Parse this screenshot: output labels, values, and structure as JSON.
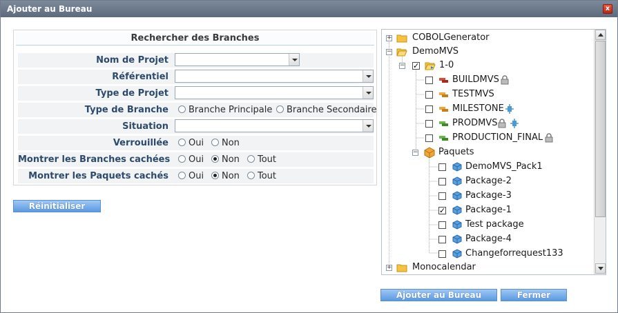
{
  "window": {
    "title": "Ajouter au Bureau",
    "close_label": "x"
  },
  "search": {
    "title": "Rechercher des Branches",
    "fields": {
      "nom_projet": {
        "label": "Nom de Projet",
        "value": ""
      },
      "referentiel": {
        "label": "Référentiel",
        "value": ""
      },
      "type_projet": {
        "label": "Type de Projet",
        "value": ""
      },
      "type_branche": {
        "label": "Type de Branche",
        "options": [
          "Branche Principale",
          "Branche Secondaire"
        ],
        "selected": null
      },
      "situation": {
        "label": "Situation",
        "value": ""
      },
      "verrouillee": {
        "label": "Verrouillée",
        "options": [
          "Oui",
          "Non"
        ],
        "selected": null
      },
      "branches_cachees": {
        "label": "Montrer les Branches cachées",
        "options": [
          "Oui",
          "Non",
          "Tout"
        ],
        "selected": "Non"
      },
      "paquets_caches": {
        "label": "Montrer les Paquets cachés",
        "options": [
          "Oui",
          "Non",
          "Tout"
        ],
        "selected": "Non"
      }
    },
    "reset_label": "Réinitialiser"
  },
  "tree": {
    "nodes": [
      {
        "label": "COBOLGenerator",
        "icon": "folder-icon",
        "expanded": false
      },
      {
        "label": "DemoMVS",
        "icon": "folder-open-icon",
        "expanded": true
      },
      {
        "label": "1-0",
        "icon": "folder-open-icon",
        "expanded": true,
        "checked": true
      },
      {
        "label": "BUILDMVS",
        "icon": "branch-red-icon",
        "checked": false,
        "badges": [
          "lock-icon"
        ]
      },
      {
        "label": "TESTMVS",
        "icon": "branch-orange-icon",
        "checked": false,
        "badges": []
      },
      {
        "label": "MILESTONE",
        "icon": "branch-orange-icon",
        "checked": false,
        "badges": [
          "link-icon"
        ]
      },
      {
        "label": "PRODMVS",
        "icon": "branch-green-icon",
        "checked": false,
        "badges": [
          "lock-icon",
          "link-icon"
        ]
      },
      {
        "label": "PRODUCTION_FINAL",
        "icon": "branch-green-icon",
        "checked": false,
        "badges": [
          "lock-icon"
        ]
      },
      {
        "label": "Paquets",
        "icon": "package-box-icon",
        "expanded": true
      },
      {
        "label": "DemoMVS_Pack1",
        "icon": "package-icon",
        "checked": false
      },
      {
        "label": "Package-2",
        "icon": "package-icon",
        "checked": false
      },
      {
        "label": "Package-3",
        "icon": "package-icon",
        "checked": false
      },
      {
        "label": "Package-1",
        "icon": "package-icon",
        "checked": true
      },
      {
        "label": "Test package",
        "icon": "package-icon",
        "checked": false
      },
      {
        "label": "Package-4",
        "icon": "package-icon",
        "checked": false
      },
      {
        "label": "Changeforrequest133",
        "icon": "package-icon",
        "checked": false
      },
      {
        "label": "Monocalendar",
        "icon": "folder-icon",
        "expanded": false
      }
    ]
  },
  "actions": {
    "add_label": "Ajouter au Bureau",
    "close_label": "Fermer"
  },
  "colors": {
    "titlebar": "#6c7a8c",
    "label_text": "#2e4a6a",
    "button": "#6aa6ea"
  }
}
